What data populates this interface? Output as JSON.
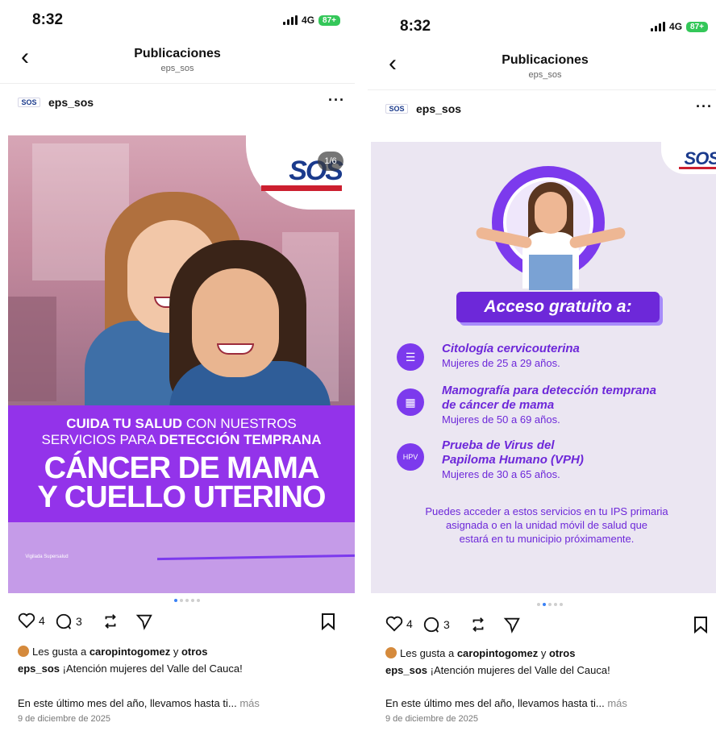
{
  "left": {
    "status": {
      "time": "8:32",
      "network": "4G",
      "battery": "87+"
    },
    "nav": {
      "back_icon": "chevron-left-icon",
      "title": "Publicaciones",
      "subtitle": "eps_sos"
    },
    "post": {
      "username": "eps_sos",
      "more": "···",
      "counter": "1/6"
    },
    "image": {
      "headline_bold1": "CUIDA TU SALUD",
      "headline_rest1": " CON NUESTROS",
      "headline_rest2": "SERVICIOS PARA ",
      "headline_bold2": "DETECCIÓN TEMPRANA",
      "big1": "CÁNCER DE MAMA",
      "big2": "Y CUELLO UTERINO",
      "logo_text": "SOS",
      "foot_logo": "Vigilada Supersalud"
    },
    "actions": {
      "likes": "4",
      "comments": "3"
    },
    "likes_line_prefix": "Les gusta a ",
    "likes_user": "caropintogomez",
    "likes_suffix": " y ",
    "likes_others": "otros",
    "caption_user": "eps_sos",
    "caption_text": " ¡Atención mujeres del Valle del Cauca!",
    "desc_text": "En este último mes del año, llevamos hasta ti... ",
    "desc_more": "más",
    "date": "9 de diciembre de 2025"
  },
  "right": {
    "status": {
      "time": "8:32",
      "network": "4G",
      "battery": "87+"
    },
    "nav": {
      "title": "Publicaciones",
      "subtitle": "eps_sos"
    },
    "post": {
      "username": "eps_sos",
      "more": "···"
    },
    "image": {
      "logo_text": "SOS",
      "access_title": "Acceso gratuito a:",
      "services": [
        {
          "title": "Citología cervicouterina",
          "subtitle": "Mujeres de 25 a 29 años."
        },
        {
          "title1": "Mamografía para detección temprana",
          "title2": "de cáncer de mama",
          "subtitle": "Mujeres de 50 a 69 años."
        },
        {
          "title1": "Prueba de Virus del",
          "title2": "Papiloma Humano (VPH)",
          "subtitle": "Mujeres de 30 a 65 años.",
          "icon_label": "HPV"
        }
      ],
      "foot1": "Puedes acceder a estos servicios en tu IPS primaria",
      "foot2": "asignada o en la unidad móvil de salud que",
      "foot3": "estará en tu municipio próximamente."
    },
    "actions": {
      "likes": "4",
      "comments": "3"
    },
    "likes_line_prefix": "Les gusta a ",
    "likes_user": "caropintogomez",
    "likes_suffix": " y ",
    "likes_others": "otros",
    "caption_user": "eps_sos",
    "caption_text": " ¡Atención mujeres del Valle del Cauca!",
    "desc_text": "En este último mes del año, llevamos hasta ti... ",
    "desc_more": "más",
    "date": "9 de diciembre de 2025"
  },
  "colors": {
    "brand_purple": "#9333ea",
    "deep_purple": "#6d28d9",
    "sos_blue": "#1a3a8c",
    "sos_red": "#cc1f2f",
    "dot_active": "#3b82f6"
  }
}
